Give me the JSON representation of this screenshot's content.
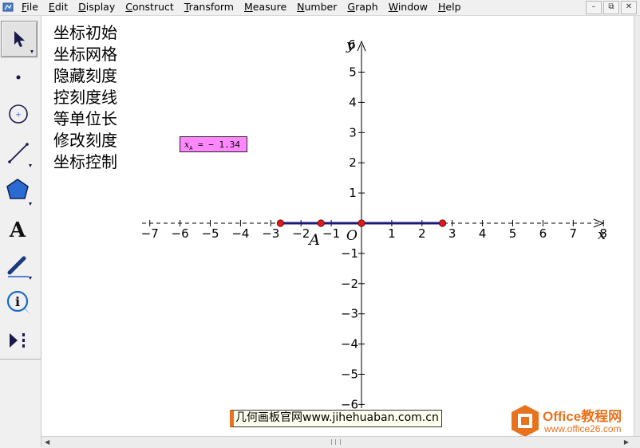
{
  "menu": {
    "items": [
      {
        "first": "F",
        "rest": "ile"
      },
      {
        "first": "E",
        "rest": "dit"
      },
      {
        "first": "D",
        "rest": "isplay"
      },
      {
        "first": "C",
        "rest": "onstruct"
      },
      {
        "first": "T",
        "rest": "ransform"
      },
      {
        "first": "M",
        "rest": "easure"
      },
      {
        "first": "N",
        "rest": "umber"
      },
      {
        "first": "G",
        "rest": "raph"
      },
      {
        "first": "W",
        "rest": "indow"
      },
      {
        "first": "H",
        "rest": "elp"
      }
    ],
    "window_buttons": [
      "–",
      "⧉",
      "✕"
    ]
  },
  "toolbox": {
    "tools": [
      {
        "name": "arrow-tool-icon",
        "selected": true
      },
      {
        "name": "point-tool-icon"
      },
      {
        "name": "compass-tool-icon"
      },
      {
        "name": "straightedge-tool-icon"
      },
      {
        "name": "polygon-tool-icon"
      },
      {
        "name": "text-tool-icon",
        "glyph": "A"
      },
      {
        "name": "marker-tool-icon"
      },
      {
        "name": "information-tool-icon"
      },
      {
        "name": "custom-tool-icon"
      }
    ]
  },
  "buttons": [
    "坐标初始",
    "坐标网格",
    "隐藏刻度",
    "控刻度线",
    "等单位长",
    "修改刻度",
    "坐标控制"
  ],
  "measurement": {
    "var": "x",
    "sub": "A",
    "text": " =  − 1.34"
  },
  "graph": {
    "x_ticks": [
      "−7",
      "−6",
      "−5",
      "−4",
      "−3",
      "−2",
      "−1",
      "0",
      "1",
      "2",
      "3",
      "4",
      "5",
      "6",
      "7",
      "8"
    ],
    "y_ticks_pos": [
      "5",
      "4",
      "3",
      "2",
      "1"
    ],
    "y_ticks_neg": [
      "−1",
      "−2",
      "−3",
      "−4",
      "−5",
      "−6"
    ],
    "x_axis_label": "x",
    "y_axis_label": "y",
    "top_label": "6",
    "origin_label": "O",
    "point_label": "A",
    "segment": {
      "x_start": -2.68,
      "x_end": 2.68
    },
    "points": [
      -2.68,
      -1.34,
      0,
      2.68
    ],
    "point_A_x": -1.34,
    "colors": {
      "segment": "#1a1a7a",
      "point": "#e01b1b",
      "axis": "#000000"
    }
  },
  "watermark": "几何画板官网www.jihehuaban.com.cn",
  "logo": {
    "title": "Office教程网",
    "url": "www.office26.com"
  }
}
